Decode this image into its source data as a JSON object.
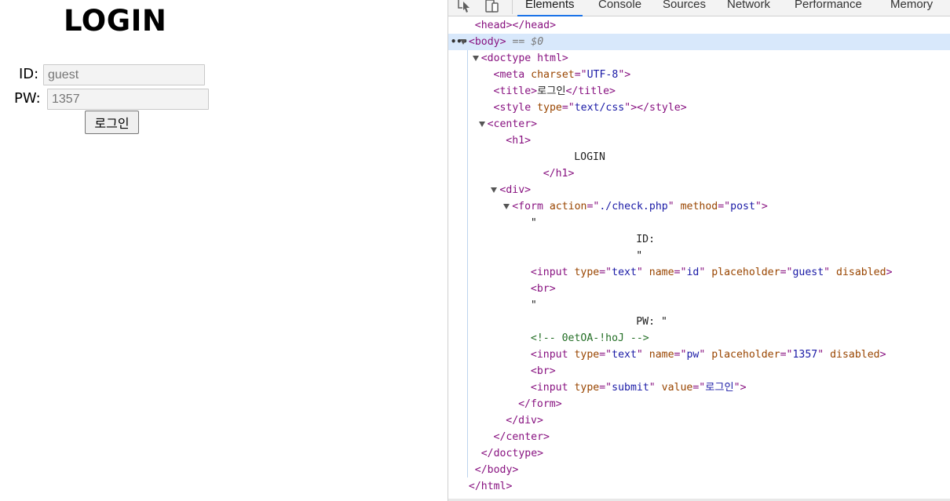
{
  "page": {
    "heading": "LOGIN",
    "id_label": "ID:",
    "id_placeholder": "guest",
    "pw_label": "PW:",
    "pw_placeholder": "1357",
    "submit_label": "로그인"
  },
  "devtools": {
    "tabs": [
      {
        "label": "Elements",
        "active": true
      },
      {
        "label": "Console",
        "active": false
      },
      {
        "label": "Sources",
        "active": false
      },
      {
        "label": "Network",
        "active": false
      },
      {
        "label": "Performance",
        "active": false
      },
      {
        "label": "Memory",
        "active": false
      }
    ],
    "toolbar_icons": [
      "inspect-element-icon",
      "device-toolbar-icon"
    ],
    "selected_marker": "== $0",
    "lines": [
      {
        "indent": 2,
        "tri": false,
        "html": "<span class=\"tag\">&lt;head&gt;&lt;/head&gt;</span>"
      },
      {
        "indent": 1,
        "tri": true,
        "selected": true,
        "dots": true,
        "html": "<span class=\"tag\">&lt;body&gt;</span> <span class=\"dim\">== $0</span>"
      },
      {
        "indent": 3,
        "tri": true,
        "html": "<span class=\"tag\">&lt;doctype html&gt;</span>"
      },
      {
        "indent": 5,
        "tri": false,
        "html": "<span class=\"tag\">&lt;meta </span><span class=\"attr-name\">charset</span><span class=\"tag\">=\"</span><span class=\"attr-val\">UTF-8</span><span class=\"tag\">\"&gt;</span>"
      },
      {
        "indent": 5,
        "tri": false,
        "html": "<span class=\"tag\">&lt;title&gt;</span><span class=\"txt\">로그인</span><span class=\"tag\">&lt;/title&gt;</span>"
      },
      {
        "indent": 5,
        "tri": false,
        "html": "<span class=\"tag\">&lt;style </span><span class=\"attr-name\">type</span><span class=\"tag\">=\"</span><span class=\"attr-val\">text/css</span><span class=\"tag\">\"&gt;&lt;/style&gt;</span>"
      },
      {
        "indent": 4,
        "tri": true,
        "html": "<span class=\"tag\">&lt;center&gt;</span>"
      },
      {
        "indent": 7,
        "tri": false,
        "html": "<span class=\"tag\">&lt;h1&gt;</span>"
      },
      {
        "indent": 18,
        "tri": false,
        "html": "<span class=\"txt\">LOGIN</span>"
      },
      {
        "indent": 13,
        "tri": false,
        "html": "<span class=\"tag\">&lt;/h1&gt;</span>"
      },
      {
        "indent": 6,
        "tri": true,
        "html": "<span class=\"tag\">&lt;div&gt;</span>"
      },
      {
        "indent": 8,
        "tri": true,
        "html": "<span class=\"tag\">&lt;form </span><span class=\"attr-name\">action</span><span class=\"tag\">=\"</span><span class=\"attr-val\">./check.php</span><span class=\"tag\">\" </span><span class=\"attr-name\">method</span><span class=\"tag\">=\"</span><span class=\"attr-val\">post</span><span class=\"tag\">\"&gt;</span>"
      },
      {
        "indent": 11,
        "tri": false,
        "html": "<span class=\"txt\">\"</span>"
      },
      {
        "indent": 28,
        "tri": false,
        "html": "<span class=\"txt\">ID:</span>"
      },
      {
        "indent": 28,
        "tri": false,
        "html": "<span class=\"txt\">\"</span>"
      },
      {
        "indent": 11,
        "tri": false,
        "html": "<span class=\"tag\">&lt;input </span><span class=\"attr-name\">type</span><span class=\"tag\">=\"</span><span class=\"attr-val\">text</span><span class=\"tag\">\" </span><span class=\"attr-name\">name</span><span class=\"tag\">=\"</span><span class=\"attr-val\">id</span><span class=\"tag\">\" </span><span class=\"attr-name\">placeholder</span><span class=\"tag\">=\"</span><span class=\"attr-val\">guest</span><span class=\"tag\">\" </span><span class=\"attr-name\">disabled</span><span class=\"tag\">&gt;</span>"
      },
      {
        "indent": 11,
        "tri": false,
        "html": "<span class=\"tag\">&lt;br&gt;</span>"
      },
      {
        "indent": 11,
        "tri": false,
        "html": "<span class=\"txt\">\"</span>"
      },
      {
        "indent": 28,
        "tri": false,
        "html": "<span class=\"txt\">PW: \"</span>"
      },
      {
        "indent": 11,
        "tri": false,
        "html": "<span class=\"comment\">&lt;!-- 0etOA-!hoJ --&gt;</span>"
      },
      {
        "indent": 11,
        "tri": false,
        "html": "<span class=\"tag\">&lt;input </span><span class=\"attr-name\">type</span><span class=\"tag\">=\"</span><span class=\"attr-val\">text</span><span class=\"tag\">\" </span><span class=\"attr-name\">name</span><span class=\"tag\">=\"</span><span class=\"attr-val\">pw</span><span class=\"tag\">\" </span><span class=\"attr-name\">placeholder</span><span class=\"tag\">=\"</span><span class=\"attr-val\">1357</span><span class=\"tag\">\" </span><span class=\"attr-name\">disabled</span><span class=\"tag\">&gt;</span>"
      },
      {
        "indent": 11,
        "tri": false,
        "html": "<span class=\"tag\">&lt;br&gt;</span>"
      },
      {
        "indent": 11,
        "tri": false,
        "html": "<span class=\"tag\">&lt;input </span><span class=\"attr-name\">type</span><span class=\"tag\">=\"</span><span class=\"attr-val\">submit</span><span class=\"tag\">\" </span><span class=\"attr-name\">value</span><span class=\"tag\">=\"</span><span class=\"attr-val\">로그인</span><span class=\"tag\">\"&gt;</span>"
      },
      {
        "indent": 9,
        "tri": false,
        "html": "<span class=\"tag\">&lt;/form&gt;</span>"
      },
      {
        "indent": 7,
        "tri": false,
        "html": "<span class=\"tag\">&lt;/div&gt;</span>"
      },
      {
        "indent": 5,
        "tri": false,
        "html": "<span class=\"tag\">&lt;/center&gt;</span>"
      },
      {
        "indent": 3,
        "tri": false,
        "html": "<span class=\"tag\">&lt;/doctype&gt;</span>"
      },
      {
        "indent": 2,
        "tri": false,
        "html": "<span class=\"tag\">&lt;/body&gt;</span>"
      },
      {
        "indent": 1,
        "tri": false,
        "html": "<span class=\"tag\">&lt;/html&gt;</span>"
      }
    ]
  }
}
